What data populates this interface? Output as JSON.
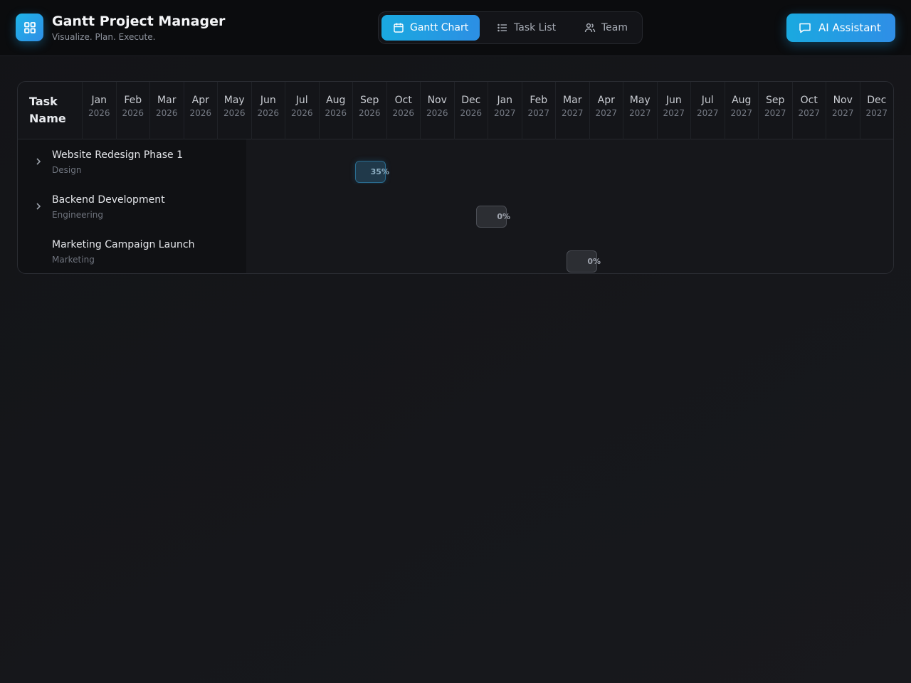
{
  "app": {
    "title": "Gantt Project Manager",
    "subtitle": "Visualize. Plan. Execute."
  },
  "nav": {
    "tabs": [
      {
        "label": "Gantt Chart",
        "icon": "calendar-icon",
        "active": true
      },
      {
        "label": "Task List",
        "icon": "list-icon",
        "active": false
      },
      {
        "label": "Team",
        "icon": "users-icon",
        "active": false
      }
    ]
  },
  "assistant": {
    "label": "AI Assistant",
    "icon": "chat-icon"
  },
  "gantt": {
    "task_column_title": "Task Name",
    "months": [
      {
        "month": "Jan",
        "year": "2026"
      },
      {
        "month": "Feb",
        "year": "2026"
      },
      {
        "month": "Mar",
        "year": "2026"
      },
      {
        "month": "Apr",
        "year": "2026"
      },
      {
        "month": "May",
        "year": "2026"
      },
      {
        "month": "Jun",
        "year": "2026"
      },
      {
        "month": "Jul",
        "year": "2026"
      },
      {
        "month": "Aug",
        "year": "2026"
      },
      {
        "month": "Sep",
        "year": "2026"
      },
      {
        "month": "Oct",
        "year": "2026"
      },
      {
        "month": "Nov",
        "year": "2026"
      },
      {
        "month": "Dec",
        "year": "2026"
      },
      {
        "month": "Jan",
        "year": "2027"
      },
      {
        "month": "Feb",
        "year": "2027"
      },
      {
        "month": "Mar",
        "year": "2027"
      },
      {
        "month": "Apr",
        "year": "2027"
      },
      {
        "month": "May",
        "year": "2027"
      },
      {
        "month": "Jun",
        "year": "2027"
      },
      {
        "month": "Jul",
        "year": "2027"
      },
      {
        "month": "Aug",
        "year": "2027"
      },
      {
        "month": "Sep",
        "year": "2027"
      },
      {
        "month": "Oct",
        "year": "2027"
      },
      {
        "month": "Nov",
        "year": "2027"
      },
      {
        "month": "Dec",
        "year": "2027"
      }
    ],
    "tasks": [
      {
        "name": "Website Redesign Phase 1",
        "category": "Design",
        "progress": "35%",
        "expandable": true,
        "color": "#2a6b8e"
      },
      {
        "name": "Backend Development",
        "category": "Engineering",
        "progress": "0%",
        "expandable": true,
        "color": "#4a4d54"
      },
      {
        "name": "Marketing Campaign Launch",
        "category": "Marketing",
        "progress": "0%",
        "expandable": false,
        "color": "#4a4d54"
      }
    ]
  },
  "colors": {
    "accent": "#1aa9e0",
    "accent_end": "#2f8ee6",
    "background": "#151619"
  }
}
